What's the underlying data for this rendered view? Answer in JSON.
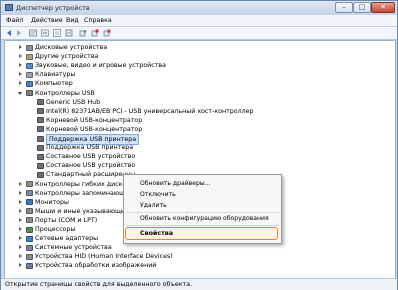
{
  "window": {
    "title": "Диспетчер устройств",
    "buttons": {
      "minimize": "–",
      "maximize": "□",
      "close": "✕"
    }
  },
  "menu": [
    "Файл",
    "Действие",
    "Вид",
    "Справка"
  ],
  "toolbar_icons": [
    "back-icon",
    "forward-icon",
    "properties-icon",
    "show-hidden-icon",
    "help-icon",
    "scan-icon",
    "update-driver-icon",
    "disable-device-icon",
    "uninstall-device-icon"
  ],
  "tree": [
    {
      "label": "Дисковые устройства",
      "expanded": false,
      "level": 0,
      "icon": "disk-icon"
    },
    {
      "label": "Другие устройства",
      "expanded": false,
      "level": 0,
      "icon": "other-devices-icon"
    },
    {
      "label": "Звуковые, видео и игровые устройства",
      "expanded": false,
      "level": 0,
      "icon": "sound-icon"
    },
    {
      "label": "Клавиатуры",
      "expanded": false,
      "level": 0,
      "icon": "keyboard-icon"
    },
    {
      "label": "Компьютер",
      "expanded": false,
      "level": 0,
      "icon": "computer-icon"
    },
    {
      "label": "Контроллеры USB",
      "expanded": true,
      "level": 0,
      "icon": "usb-icon"
    },
    {
      "label": "Generic USB Hub",
      "level": 1,
      "icon": "usb-device-icon"
    },
    {
      "label": "Intel(R) 82371AB/EB PCI - USB универсальный хост-контроллер",
      "level": 1,
      "icon": "usb-device-icon"
    },
    {
      "label": "Корневой USB-концентратор",
      "level": 1,
      "icon": "usb-device-icon"
    },
    {
      "label": "Корневой USB-концентратор",
      "level": 1,
      "icon": "usb-device-icon"
    },
    {
      "label": "Поддержка USB принтера",
      "level": 1,
      "icon": "usb-device-icon",
      "selected": true
    },
    {
      "label": "Поддержка USB принтера",
      "level": 1,
      "icon": "usb-device-icon"
    },
    {
      "label": "Составное USB устройство",
      "level": 1,
      "icon": "usb-device-icon"
    },
    {
      "label": "Составное USB устройство",
      "level": 1,
      "icon": "usb-device-icon"
    },
    {
      "label": "Стандартный расширенны",
      "level": 1,
      "icon": "usb-device-icon"
    },
    {
      "label": "Контроллеры гибких дисков",
      "expanded": false,
      "level": 0,
      "icon": "floppy-controller-icon"
    },
    {
      "label": "Контроллеры запоминающ",
      "expanded": false,
      "level": 0,
      "icon": "storage-controller-icon"
    },
    {
      "label": "Мониторы",
      "expanded": false,
      "level": 0,
      "icon": "monitor-icon"
    },
    {
      "label": "Мыши и иные указывающие устройства",
      "expanded": false,
      "level": 0,
      "icon": "mouse-icon"
    },
    {
      "label": "Порты (COM и LPT)",
      "expanded": false,
      "level": 0,
      "icon": "port-icon"
    },
    {
      "label": "Процессоры",
      "expanded": false,
      "level": 0,
      "icon": "cpu-icon"
    },
    {
      "label": "Сетевые адаптеры",
      "expanded": false,
      "level": 0,
      "icon": "network-icon"
    },
    {
      "label": "Системные устройства",
      "expanded": false,
      "level": 0,
      "icon": "system-icon"
    },
    {
      "label": "Устройства HID (Human Interface Devices)",
      "expanded": false,
      "level": 0,
      "icon": "hid-icon"
    },
    {
      "label": "Устройства обработки изображений",
      "expanded": false,
      "level": 0,
      "icon": "imaging-icon"
    }
  ],
  "context_menu": {
    "update_driver": "Обновить драйверы...",
    "disable": "Отключить",
    "uninstall": "Удалить",
    "scan": "Обновить конфигурацию оборудования",
    "properties": "Свойства"
  },
  "statusbar": "Открытие страницы свойств для выделенного объекта.",
  "colors": {
    "accent": "#e8861e",
    "selection": "#cfe3fb"
  }
}
